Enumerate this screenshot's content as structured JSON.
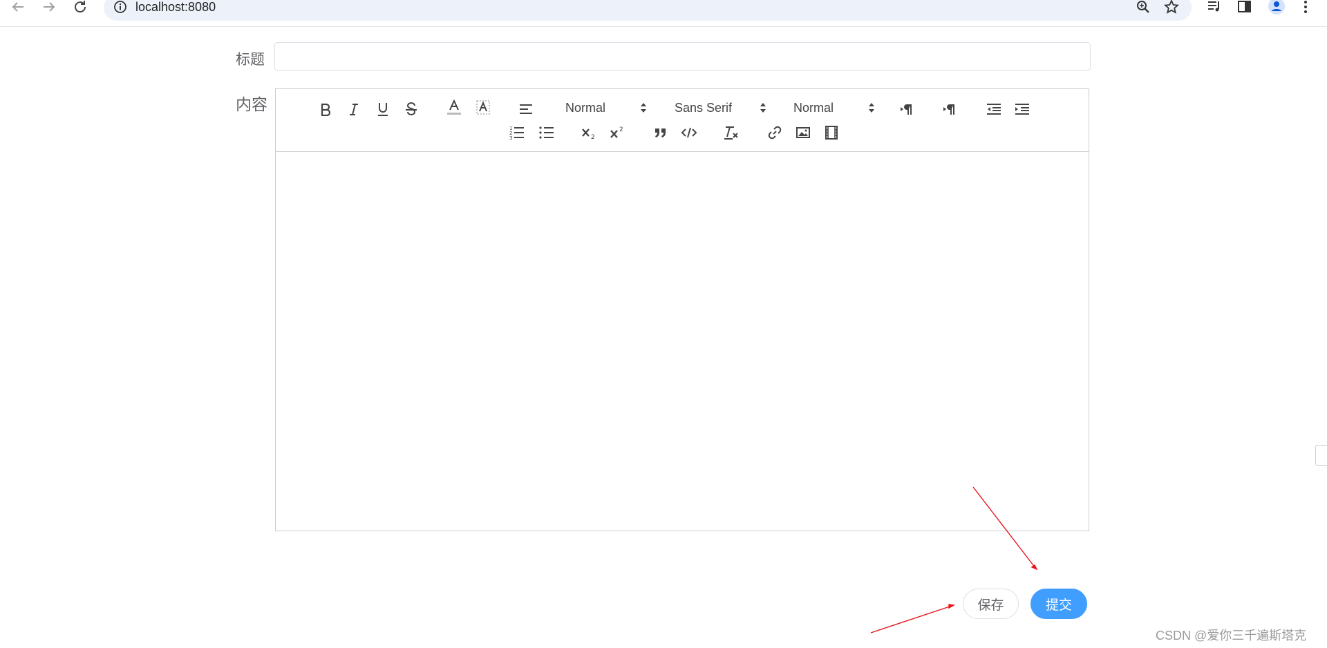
{
  "browser": {
    "url": "localhost:8080",
    "icons": [
      "back-arrow-icon",
      "forward-arrow-icon",
      "reload-icon",
      "info-icon",
      "zoom-icon",
      "star-icon",
      "media-icon",
      "side-panel-icon",
      "profile-icon",
      "menu-icon"
    ]
  },
  "form": {
    "title_label": "标题",
    "title_value": "",
    "content_label": "内容"
  },
  "toolbar": {
    "header_picker": "Normal",
    "font_picker": "Sans Serif",
    "size_picker": "Normal",
    "buttons": [
      "bold",
      "italic",
      "underline",
      "strike",
      "color",
      "background",
      "align",
      "direction-ltr",
      "direction-rtl",
      "outdent",
      "indent",
      "ordered-list",
      "bullet-list",
      "subscript",
      "superscript",
      "blockquote",
      "code-block",
      "clean",
      "link",
      "image",
      "video"
    ]
  },
  "editor": {
    "content": ""
  },
  "actions": {
    "save_label": "保存",
    "submit_label": "提交"
  },
  "watermark": "CSDN @爱你三千遍斯塔克",
  "colors": {
    "primary": "#409eff",
    "annotation_arrow": "#e8141c",
    "border": "#cccccc"
  }
}
